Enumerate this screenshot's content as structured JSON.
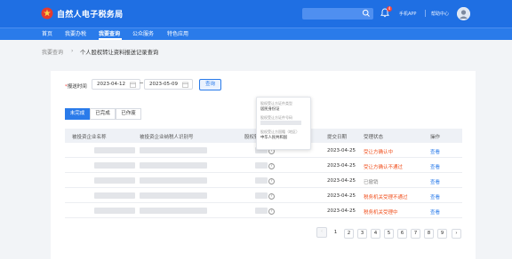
{
  "header": {
    "app_title": "自然人电子税务局",
    "notification_count": "4",
    "mobile_app": "手机APP",
    "help_center": "帮助中心"
  },
  "nav": {
    "items": [
      "首页",
      "我要办税",
      "我要查询",
      "公众服务",
      "特色应用"
    ],
    "active_index": 2
  },
  "breadcrumb": {
    "parent": "我要查询",
    "separator": "›",
    "current": "个人股权转让资料报送记录查询"
  },
  "filter": {
    "label_required": "*",
    "label": "报送时间",
    "start_date": "2023-04-12",
    "end_date": "2023-05-09",
    "query_button": "查询"
  },
  "tabs": [
    {
      "label": "未完成",
      "active": true
    },
    {
      "label": "已完成",
      "active": false
    },
    {
      "label": "已作废",
      "active": false
    }
  ],
  "table": {
    "columns": [
      "被投资企业名称",
      "被投资企业纳税人识别号",
      "股权转让",
      "提交日期",
      "受理状态",
      "操作"
    ],
    "rows": [
      {
        "date": "2023-04-25",
        "status": "受让方确认中",
        "status_kind": "red",
        "action": "查看"
      },
      {
        "date": "2023-04-25",
        "status": "受让方确认不通过",
        "status_kind": "red",
        "action": "查看"
      },
      {
        "date": "2023-04-25",
        "status": "已撤销",
        "status_kind": "gray",
        "action": "查看"
      },
      {
        "date": "2023-04-25",
        "status": "税务机关受理不通过",
        "status_kind": "red",
        "action": "查看"
      },
      {
        "date": "2023-04-25",
        "status": "税务机关受理中",
        "status_kind": "red",
        "action": "查看"
      }
    ]
  },
  "tooltip": {
    "items": [
      {
        "label": "股权受让方证件类型",
        "value": "居民身份证"
      },
      {
        "label": "股权受让方证件号码",
        "value": ""
      },
      {
        "label": "股权受让方国籍（地区）",
        "value": "中华人民共和国"
      }
    ]
  },
  "pagination": {
    "prev": "‹",
    "pages": [
      "1",
      "2",
      "3",
      "4",
      "5",
      "6",
      "7",
      "8",
      "9"
    ],
    "current": "1",
    "next": "›"
  },
  "colors": {
    "primary": "#2a7bea",
    "header": "#1f6fe3",
    "status_red": "#f0501e",
    "status_gray": "#888888"
  }
}
